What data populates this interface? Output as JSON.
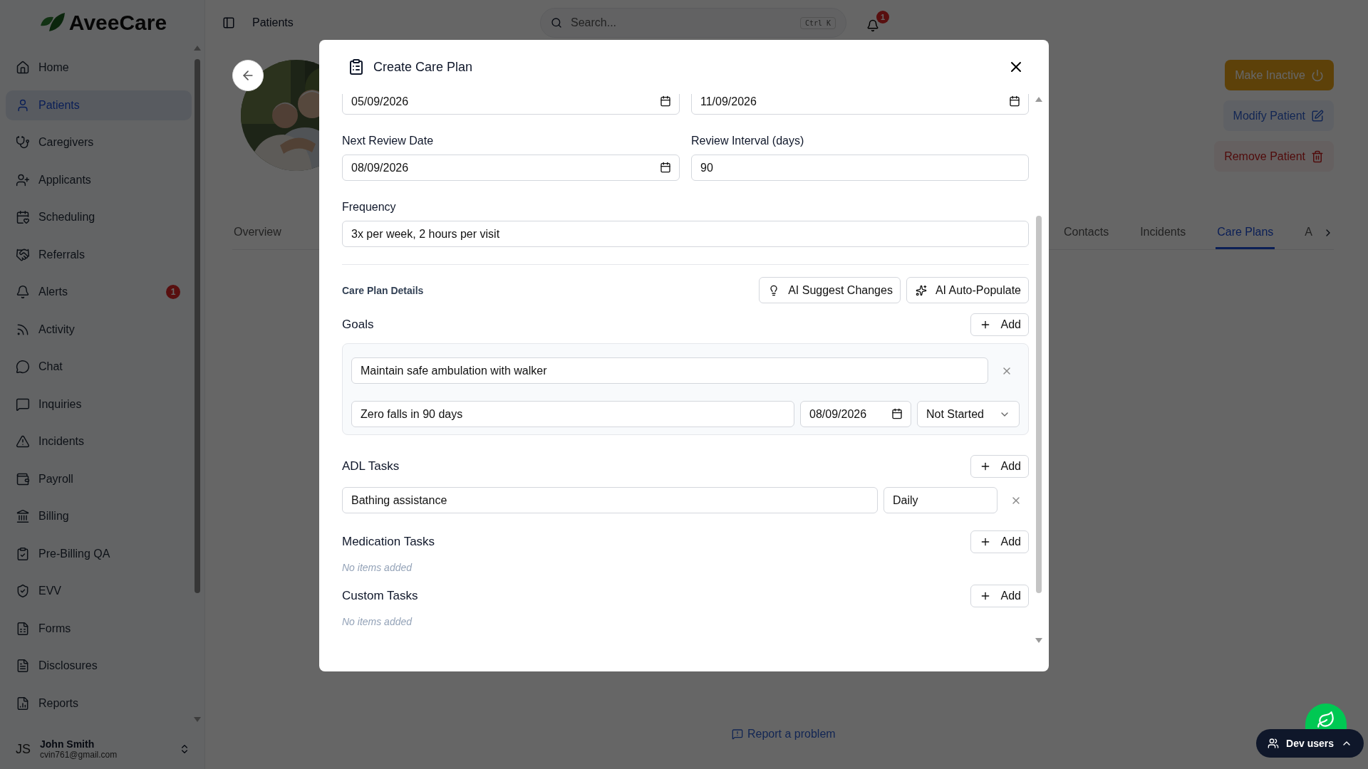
{
  "app": {
    "logo": "AveeCare"
  },
  "sidebar": {
    "items": [
      {
        "label": "Home",
        "selected": false
      },
      {
        "label": "Patients",
        "selected": true
      },
      {
        "label": "Caregivers",
        "selected": false
      },
      {
        "label": "Applicants",
        "selected": false
      },
      {
        "label": "Scheduling",
        "selected": false
      },
      {
        "label": "Referrals",
        "selected": false
      },
      {
        "label": "Alerts",
        "selected": false,
        "badge": "1"
      },
      {
        "label": "Activity",
        "selected": false
      },
      {
        "label": "Chat",
        "selected": false
      },
      {
        "label": "Inquiries",
        "selected": false
      },
      {
        "label": "Incidents",
        "selected": false
      },
      {
        "label": "Payroll",
        "selected": false
      },
      {
        "label": "Billing",
        "selected": false
      },
      {
        "label": "Pre-Billing QA",
        "selected": false
      },
      {
        "label": "EVV",
        "selected": false
      },
      {
        "label": "Forms",
        "selected": false
      },
      {
        "label": "Disclosures",
        "selected": false
      },
      {
        "label": "Reports",
        "selected": false
      }
    ],
    "user": {
      "initials": "JS",
      "name": "John Smith",
      "email": "cvin761@gmail.com"
    }
  },
  "header": {
    "title": "Patients",
    "search": {
      "placeholder": "Search...",
      "shortcut": "Ctrl K"
    },
    "notifications": "1"
  },
  "patient": {
    "actions": [
      {
        "label": "Make Inactive",
        "kind": "warning"
      },
      {
        "label": "Modify Patient",
        "kind": "edit"
      },
      {
        "label": "Remove Patient",
        "kind": "danger"
      }
    ],
    "tabs": [
      {
        "label": "Overview",
        "selected": false
      },
      {
        "label": "Contacts",
        "selected": false
      },
      {
        "label": "Incidents",
        "selected": false
      },
      {
        "label": "Care Plans",
        "selected": true
      },
      {
        "label": "A",
        "selected": false
      }
    ]
  },
  "report_link": "Report a problem",
  "dev_users": "Dev users",
  "modal": {
    "title": "Create Care Plan",
    "date_fields": [
      {
        "value": "05/09/2026"
      },
      {
        "value": "11/09/2026"
      }
    ],
    "fields": [
      {
        "label": "Next Review Date",
        "value": "08/09/2026",
        "kind": "date"
      },
      {
        "label": "Review Interval (days)",
        "value": "90",
        "kind": "text"
      }
    ],
    "frequency": {
      "label": "Frequency",
      "value": "3x per week, 2 hours per visit"
    },
    "section_title": "Care Plan Details",
    "ai_buttons": [
      "AI Suggest Changes",
      "AI Auto-Populate"
    ],
    "goals": {
      "title": "Goals",
      "add": "Add",
      "items": [
        {
          "goal": "Maintain safe ambulation with walker",
          "target": "Zero falls in 90 days",
          "date": "08/09/2026",
          "status": "Not Started"
        }
      ]
    },
    "adl_tasks": {
      "title": "ADL Tasks",
      "add": "Add",
      "items": [
        {
          "task": "Bathing assistance",
          "frequency": "Daily"
        }
      ]
    },
    "medication_tasks": {
      "title": "Medication Tasks",
      "add": "Add",
      "empty": "No items added"
    },
    "custom_tasks": {
      "title": "Custom Tasks",
      "add": "Add",
      "empty": "No items added"
    }
  }
}
